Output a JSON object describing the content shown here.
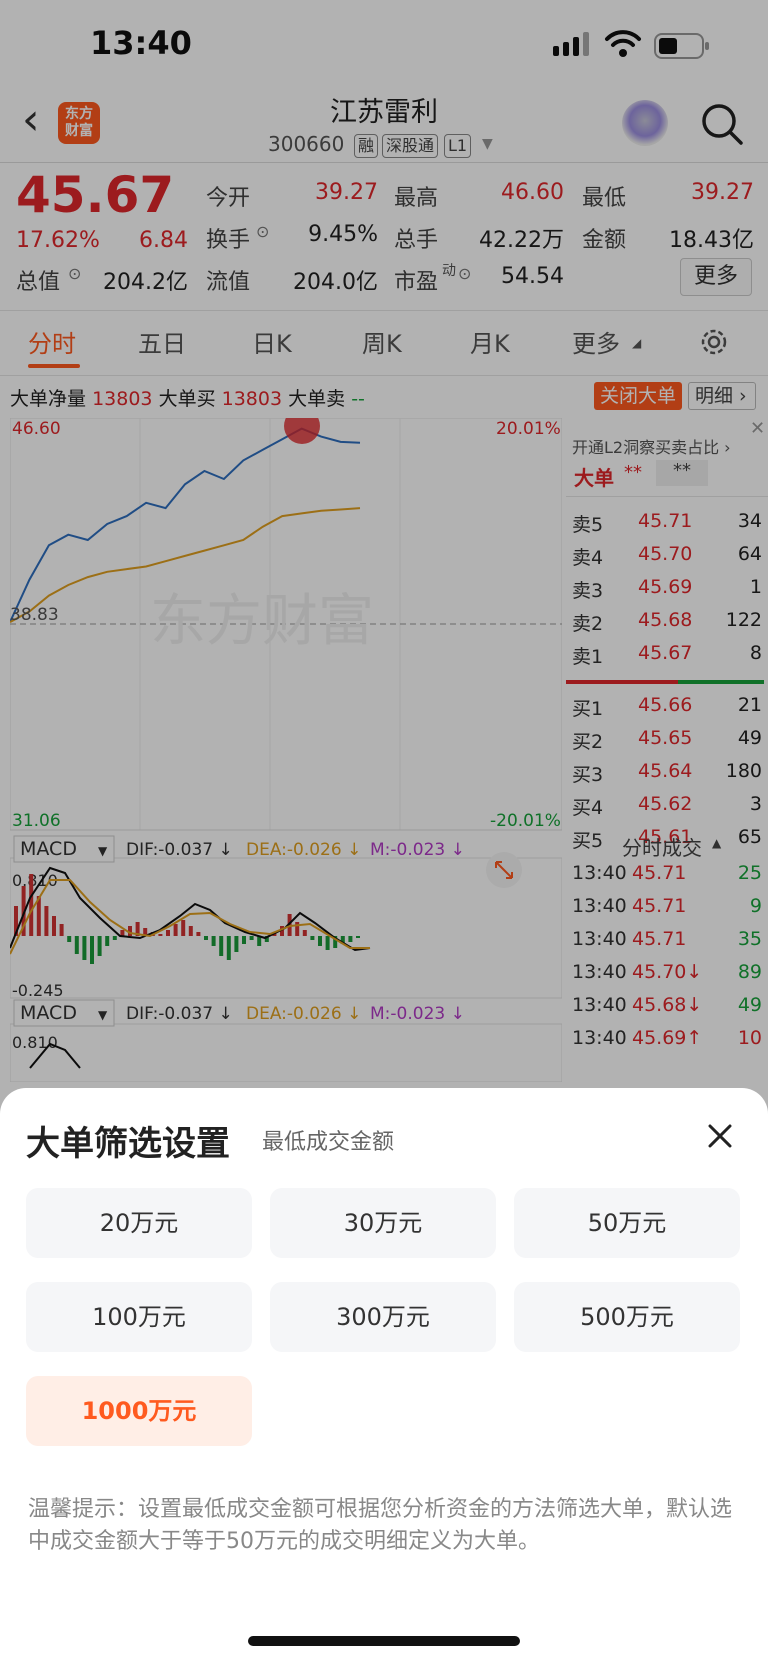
{
  "status": {
    "time": "13:40"
  },
  "header": {
    "title": "江苏雷利",
    "code": "300660",
    "tags": [
      "融",
      "深股通",
      "L1"
    ],
    "logo_text": "东方\n财富"
  },
  "quote": {
    "price": "45.67",
    "change_pct": "17.62%",
    "change": "6.84",
    "fields": [
      {
        "label": "今开",
        "value": "39.27",
        "color": "red"
      },
      {
        "label": "最高",
        "value": "46.60",
        "color": "red"
      },
      {
        "label": "最低",
        "value": "39.27",
        "color": "red"
      },
      {
        "label": "换手",
        "value": "9.45%",
        "color": "black"
      },
      {
        "label": "总手",
        "value": "42.22万",
        "color": "black"
      },
      {
        "label": "金额",
        "value": "18.43亿",
        "color": "black"
      },
      {
        "label": "总值",
        "value": "204.2亿",
        "color": "black"
      },
      {
        "label": "流值",
        "value": "204.0亿",
        "color": "black"
      },
      {
        "label": "市盈",
        "superscript": "动",
        "value": "54.54",
        "color": "black"
      }
    ],
    "more_label": "更多"
  },
  "tabs": [
    "分时",
    "五日",
    "日K",
    "周K",
    "月K",
    "更多"
  ],
  "big_order_bar": {
    "net_label": "大单净量",
    "net_value": "13803",
    "buy_label": "大单买",
    "buy_value": "13803",
    "sell_label": "大单卖",
    "sell_value": "--",
    "close_label": "关闭大单",
    "detail_label": "明细"
  },
  "chart": {
    "top_left": "46.60",
    "top_right": "20.01%",
    "mid_left": "38.83",
    "bottom_left": "31.06",
    "bottom_right": "-20.01%",
    "watermark": "东方财富",
    "macd1": {
      "name": "MACD",
      "dif": "DIF:-0.037 ↓",
      "dea": "DEA:-0.026 ↓",
      "m": "M:-0.023 ↓",
      "top": "0.810",
      "bottom": "-0.245"
    },
    "macd2": {
      "name": "MACD",
      "dif": "DIF:-0.037 ↓",
      "dea": "DEA:-0.026 ↓",
      "m": "M:-0.023 ↓",
      "top": "0.810"
    }
  },
  "chart_data": {
    "type": "line",
    "series": [
      {
        "name": "price",
        "values": [
          38.9,
          40.5,
          41.8,
          42.2,
          42.0,
          42.6,
          42.9,
          43.4,
          43.2,
          44.1,
          44.6,
          44.3,
          45.0,
          45.4,
          45.8,
          46.2,
          45.9,
          45.7,
          45.67
        ]
      },
      {
        "name": "avg",
        "values": [
          38.9,
          39.3,
          39.9,
          40.3,
          40.6,
          40.8,
          40.9,
          41.0,
          41.2,
          41.4,
          41.6,
          41.8,
          42.0,
          42.5,
          42.9,
          43.0,
          43.1,
          43.15,
          43.2
        ]
      }
    ],
    "ylim": [
      31.06,
      46.6
    ]
  },
  "side": {
    "l2_label": "开通L2洞察买卖占比 ›",
    "big_label": "大单",
    "big_v1": "**",
    "big_v2": "**",
    "sell": [
      {
        "label": "卖5",
        "price": "45.71",
        "vol": "34"
      },
      {
        "label": "卖4",
        "price": "45.70",
        "vol": "64"
      },
      {
        "label": "卖3",
        "price": "45.69",
        "vol": "1"
      },
      {
        "label": "卖2",
        "price": "45.68",
        "vol": "122"
      },
      {
        "label": "卖1",
        "price": "45.67",
        "vol": "8"
      }
    ],
    "buy": [
      {
        "label": "买1",
        "price": "45.66",
        "vol": "21"
      },
      {
        "label": "买2",
        "price": "45.65",
        "vol": "49"
      },
      {
        "label": "买3",
        "price": "45.64",
        "vol": "180"
      },
      {
        "label": "买4",
        "price": "45.62",
        "vol": "3"
      },
      {
        "label": "买5",
        "price": "45.61",
        "vol": "65"
      }
    ],
    "ticks_title": "分时成交",
    "ticks": [
      {
        "time": "13:40",
        "price": "45.71",
        "vol": "25"
      },
      {
        "time": "13:40",
        "price": "45.71",
        "vol": "9"
      },
      {
        "time": "13:40",
        "price": "45.71",
        "vol": "35"
      },
      {
        "time": "13:40",
        "price": "45.70↓",
        "vol": "89"
      },
      {
        "time": "13:40",
        "price": "45.68↓",
        "vol": "49"
      },
      {
        "time": "13:40",
        "price": "45.69↑",
        "vol": "10"
      }
    ]
  },
  "sheet": {
    "title": "大单筛选设置",
    "subtitle": "最低成交金额",
    "options": [
      "20万元",
      "30万元",
      "50万元",
      "100万元",
      "300万元",
      "500万元",
      "1000万元"
    ],
    "selected": "1000万元",
    "tip": "温馨提示：设置最低成交金额可根据您分析资金的方法筛选大单，默认选中成交金额大于等于50万元的成交明细定义为大单。"
  }
}
